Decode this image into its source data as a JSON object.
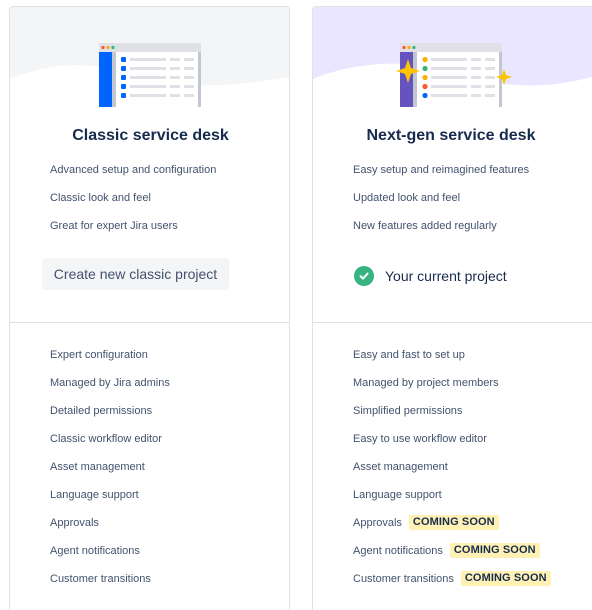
{
  "colors": {
    "nextgen_bg": "#eae6ff",
    "classic_bg": "#f4f5f7",
    "sidebar_blue": "#0065ff",
    "sidebar_purple": "#6554c0",
    "sparkle": "#ffc400",
    "check_green": "#36b37e",
    "badge_yellow": "#fff0b3"
  },
  "classic": {
    "title": "Classic service desk",
    "features": [
      "Advanced setup and configuration",
      "Classic look and feel",
      "Great for expert Jira users"
    ],
    "action_label": "Create new classic project",
    "comparisons": [
      {
        "text": "Expert configuration"
      },
      {
        "text": "Managed by Jira admins"
      },
      {
        "text": "Detailed permissions"
      },
      {
        "text": "Classic workflow editor"
      },
      {
        "text": "Asset management"
      },
      {
        "text": "Language support"
      },
      {
        "text": "Approvals"
      },
      {
        "text": "Agent notifications"
      },
      {
        "text": "Customer transitions"
      }
    ]
  },
  "nextgen": {
    "title": "Next-gen service desk",
    "features": [
      "Easy setup and reimagined features",
      "Updated look and feel",
      "New features added regularly"
    ],
    "current_label": "Your current project",
    "check_icon": "check-circle-icon",
    "comparisons": [
      {
        "text": "Easy and fast to set up"
      },
      {
        "text": "Managed by project members"
      },
      {
        "text": "Simplified permissions"
      },
      {
        "text": "Easy to use workflow editor"
      },
      {
        "text": "Asset management"
      },
      {
        "text": "Language support"
      },
      {
        "text": "Approvals",
        "badge": "COMING SOON"
      },
      {
        "text": "Agent notifications",
        "badge": "COMING SOON"
      },
      {
        "text": "Customer transitions",
        "badge": "COMING SOON"
      }
    ]
  }
}
